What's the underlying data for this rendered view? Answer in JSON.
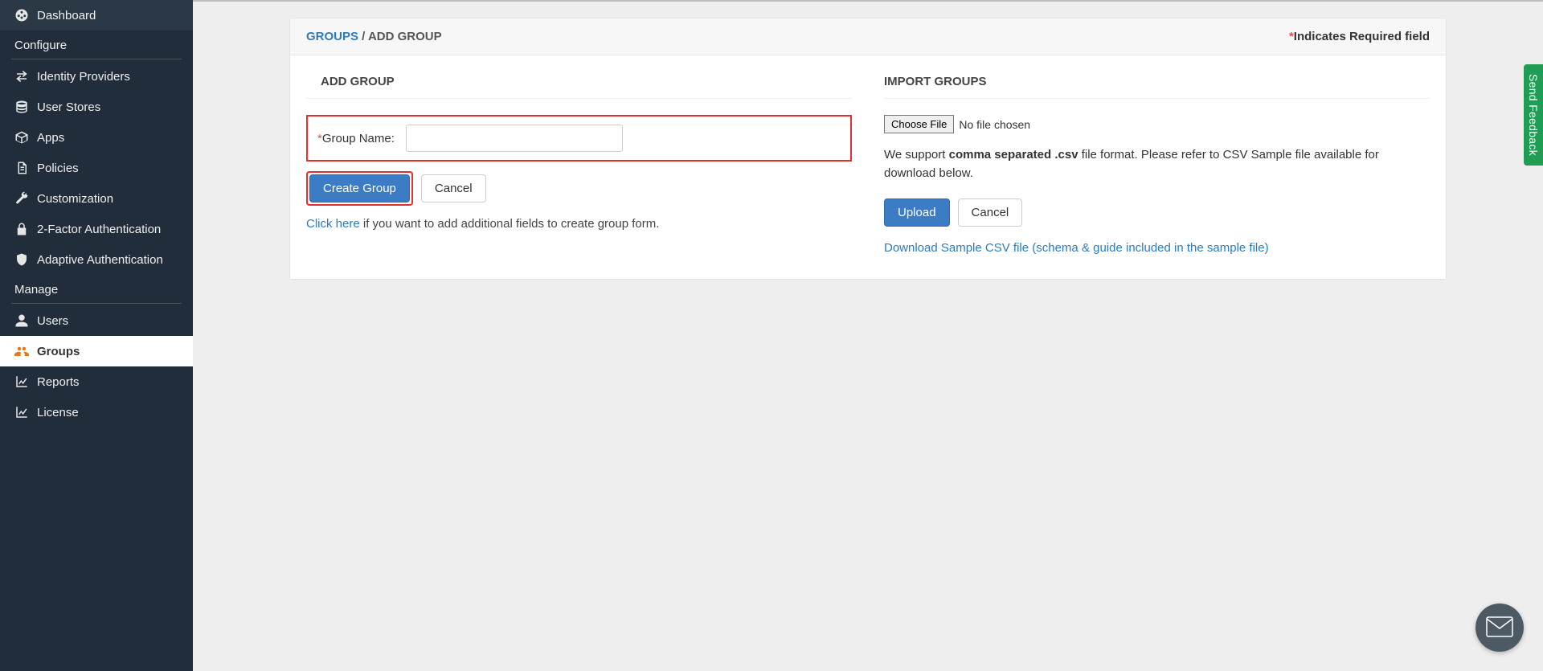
{
  "sidebar": {
    "dashboard": "Dashboard",
    "section_configure": "Configure",
    "identity_providers": "Identity Providers",
    "user_stores": "User Stores",
    "apps": "Apps",
    "policies": "Policies",
    "customization": "Customization",
    "two_factor": "2-Factor Authentication",
    "adaptive_auth": "Adaptive Authentication",
    "section_manage": "Manage",
    "users": "Users",
    "groups": "Groups",
    "reports": "Reports",
    "license": "License"
  },
  "breadcrumb": {
    "groups": "GROUPS",
    "separator": " / ",
    "current": "ADD GROUP"
  },
  "required_note": "Indicates Required field",
  "add_group": {
    "title": "ADD GROUP",
    "group_name_label": "Group Name:",
    "create_btn": "Create Group",
    "cancel_btn": "Cancel",
    "hint_link": "Click here",
    "hint_rest": " if you want to add additional fields to create group form."
  },
  "import": {
    "title": "IMPORT GROUPS",
    "choose_file": "Choose File",
    "no_file": "No file chosen",
    "support_pre": "We support ",
    "support_bold": "comma separated .csv",
    "support_post": " file format. Please refer to CSV Sample file available for download below.",
    "upload_btn": "Upload",
    "cancel_btn": "Cancel",
    "download_link": "Download Sample CSV file (schema & guide included in the sample file)"
  },
  "feedback": "Send Feedback"
}
